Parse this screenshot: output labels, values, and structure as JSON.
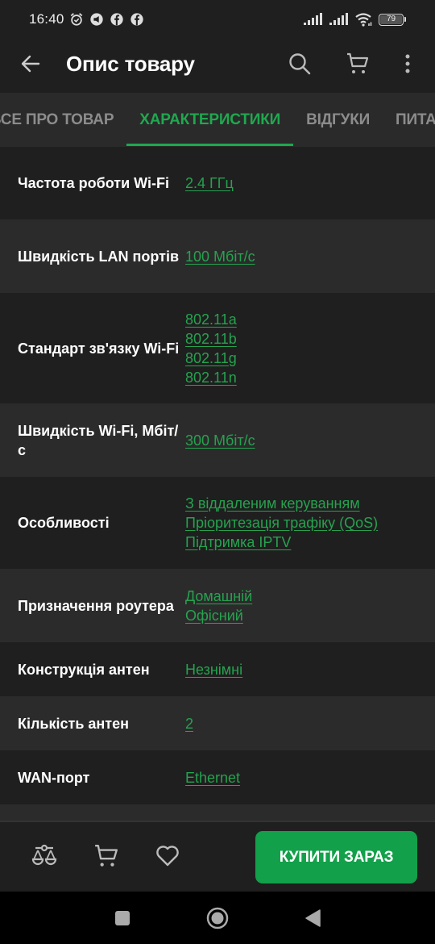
{
  "status_bar": {
    "time": "16:40",
    "notification_icons": [
      "alarm-icon",
      "megaphone-icon",
      "facebook-icon",
      "facebook-icon"
    ],
    "system_icons": [
      "signal-icon",
      "signal-icon",
      "wifi-icon"
    ],
    "battery_level": "79"
  },
  "app_bar": {
    "title": "Опис товару",
    "back_icon": "arrow-left-icon",
    "actions": [
      "search-icon",
      "cart-icon",
      "more-vert-icon"
    ]
  },
  "tabs": [
    {
      "label": "ВСЕ ПРО ТОВАР",
      "active": false
    },
    {
      "label": "ХАРАКТЕРИСТИКИ",
      "active": true
    },
    {
      "label": "ВІДГУКИ",
      "active": false
    },
    {
      "label": "ПИТАННЯ",
      "active": false
    }
  ],
  "specs": [
    {
      "label": "Частота роботи Wi-Fi",
      "values": [
        "2.4 ГГц"
      ]
    },
    {
      "label": "Швидкість LAN портів",
      "values": [
        "100 Мбіт/с"
      ]
    },
    {
      "label": "Стандарт зв'язку Wi-Fi",
      "values": [
        "802.11a",
        "802.11b",
        "802.11g",
        "802.11n"
      ]
    },
    {
      "label": "Швидкість Wi-Fi, Мбіт/с",
      "values": [
        "300 Мбіт/с"
      ]
    },
    {
      "label": "Особливості",
      "values": [
        "З віддаленим керуванням",
        "Пріоритезація трафіку (QoS)",
        "Підтримка IPTV"
      ]
    },
    {
      "label": "Призначення роутера",
      "values": [
        "Домашній",
        "Офісний"
      ]
    },
    {
      "label": "Конструкція антен",
      "values": [
        "Незнімні"
      ]
    },
    {
      "label": "Кількість антен",
      "values": [
        "2"
      ]
    },
    {
      "label": "WAN-порт",
      "values": [
        "Ethernet"
      ]
    },
    {
      "label": "",
      "values": []
    }
  ],
  "bottom_bar": {
    "icons": [
      "compare-scales-icon",
      "cart-icon",
      "heart-icon"
    ],
    "buy_label": "КУПИТИ ЗАРАЗ"
  },
  "colors": {
    "accent": "#1fa84f",
    "link": "#26a24f",
    "buy_button": "#12a04a",
    "background": "#1f1f1f",
    "row_alt": "#2b2b2b"
  }
}
